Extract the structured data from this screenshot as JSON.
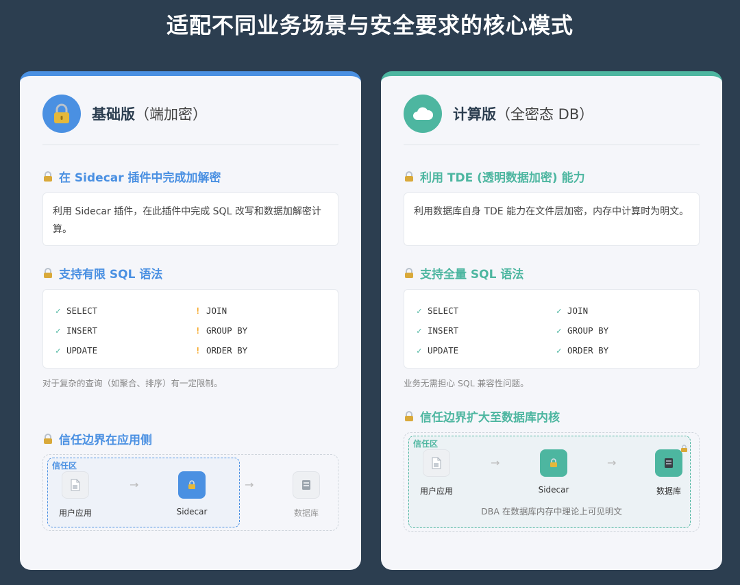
{
  "page": {
    "title": "适配不同业务场景与安全要求的核心模式"
  },
  "colors": {
    "background": "#2c3e50",
    "basic_accent": "#4a90e2",
    "compute_accent": "#4db6a0",
    "warn": "#f5a623"
  },
  "basic": {
    "icon": "lock-icon",
    "title": "基础版",
    "title_sub": "（端加密）",
    "section1": {
      "heading": "在 Sidecar 插件中完成加解密",
      "desc": "利用 Sidecar 插件，在此插件中完成 SQL 改写和数据加解密计算。"
    },
    "section2": {
      "heading": "支持有限 SQL 语法",
      "col1": [
        {
          "mark": "✓",
          "text": "SELECT"
        },
        {
          "mark": "✓",
          "text": "INSERT"
        },
        {
          "mark": "✓",
          "text": "UPDATE"
        }
      ],
      "col2": [
        {
          "mark": "!",
          "text": "JOIN"
        },
        {
          "mark": "!",
          "text": "GROUP BY"
        },
        {
          "mark": "!",
          "text": "ORDER BY"
        }
      ],
      "note": "对于复杂的查询（如聚合、排序）有一定限制。"
    },
    "section3": {
      "heading": "信任边界在应用侧",
      "zone_label": "信任区",
      "nodes": [
        {
          "label": "用户应用",
          "icon": "document-icon"
        },
        {
          "label": "Sidecar",
          "icon": "lock-icon"
        },
        {
          "label": "数据库",
          "icon": "database-icon"
        }
      ],
      "arrow": "→"
    }
  },
  "compute": {
    "icon": "cloud-icon",
    "title": "计算版",
    "title_sub": "（全密态 DB）",
    "section1": {
      "heading": "利用 TDE (透明数据加密) 能力",
      "desc": "利用数据库自身 TDE 能力在文件层加密，内存中计算时为明文。"
    },
    "section2": {
      "heading": "支持全量 SQL 语法",
      "col1": [
        {
          "mark": "✓",
          "text": "SELECT"
        },
        {
          "mark": "✓",
          "text": "INSERT"
        },
        {
          "mark": "✓",
          "text": "UPDATE"
        }
      ],
      "col2": [
        {
          "mark": "✓",
          "text": "JOIN"
        },
        {
          "mark": "✓",
          "text": "GROUP BY"
        },
        {
          "mark": "✓",
          "text": "ORDER BY"
        }
      ],
      "note": "业务无需担心 SQL 兼容性问题。"
    },
    "section3": {
      "heading": "信任边界扩大至数据库内核",
      "zone_label": "信任区",
      "nodes": [
        {
          "label": "用户应用",
          "icon": "document-icon"
        },
        {
          "label": "Sidecar",
          "icon": "lock-icon"
        },
        {
          "label": "数据库",
          "icon": "database-icon"
        }
      ],
      "arrow": "→",
      "dba_note": "DBA 在数据库内存中理论上可见明文"
    }
  }
}
